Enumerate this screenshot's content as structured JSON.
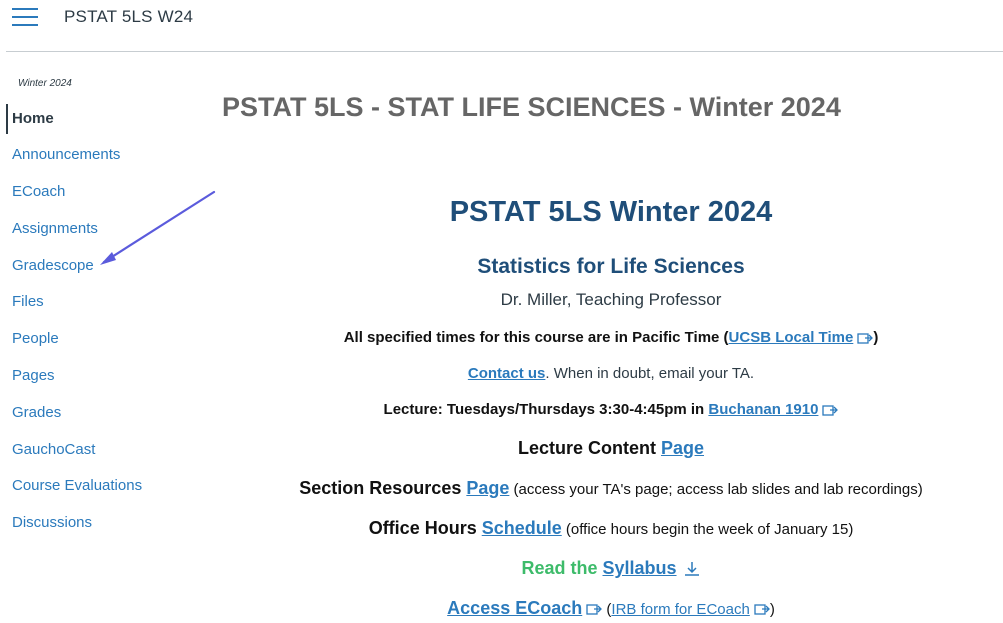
{
  "header": {
    "course_code": "PSTAT 5LS W24"
  },
  "sidebar": {
    "term": "Winter 2024",
    "items": [
      {
        "label": "Home",
        "active": true
      },
      {
        "label": "Announcements"
      },
      {
        "label": "ECoach"
      },
      {
        "label": "Assignments"
      },
      {
        "label": "Gradescope"
      },
      {
        "label": "Files"
      },
      {
        "label": "People"
      },
      {
        "label": "Pages"
      },
      {
        "label": "Grades"
      },
      {
        "label": "GauchoCast"
      },
      {
        "label": "Course Evaluations"
      },
      {
        "label": "Discussions"
      }
    ]
  },
  "main": {
    "page_title": "PSTAT 5LS - STAT LIFE SCIENCES - Winter 2024",
    "heading": "PSTAT 5LS Winter 2024",
    "subheading": "Statistics for Life Sciences",
    "professor": "Dr. Miller, Teaching Professor",
    "timezone": {
      "text": "All specified times for this course are in Pacific Time (",
      "link": "UCSB Local Time",
      "close": ")"
    },
    "contact": {
      "link": "Contact us",
      "text": ". When in doubt, email your TA."
    },
    "lecture": {
      "text": "Lecture: Tuesdays/Thursdays 3:30-4:45pm in ",
      "link": "Buchanan 1910"
    },
    "lecture_content": {
      "text": "Lecture Content ",
      "link": "Page"
    },
    "section_resources": {
      "text": "Section Resources ",
      "link": "Page",
      "note": " (access your TA's page; access lab slides and lab recordings)"
    },
    "office_hours": {
      "text": "Office Hours ",
      "link": "Schedule",
      "note": " (office hours begin the week of January 15)"
    },
    "syllabus": {
      "text": "Read the ",
      "link": "Syllabus"
    },
    "ecoach": {
      "link": "Access ECoach",
      "open": " (",
      "irb_link": "IRB form for ECoach",
      "close": ")"
    }
  },
  "colors": {
    "link": "#2b7abc",
    "heading": "#1f4e79",
    "green": "#3dbb6a",
    "annotation_arrow": "#5b5bdc"
  }
}
